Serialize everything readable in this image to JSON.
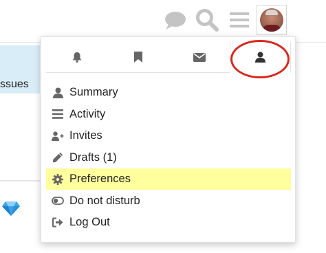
{
  "background": {
    "partial_text": "ssues",
    "highlight_color": "#d9edf9"
  },
  "header": {
    "icons": [
      "chat-icon",
      "search-icon",
      "hamburger-menu-icon",
      "avatar"
    ]
  },
  "user_menu": {
    "tabs": [
      {
        "name": "notifications",
        "icon": "bell-icon"
      },
      {
        "name": "bookmarks",
        "icon": "bookmark-icon"
      },
      {
        "name": "messages",
        "icon": "envelope-icon"
      },
      {
        "name": "profile",
        "icon": "user-icon",
        "selected": true
      }
    ],
    "annotation_color": "#d7281e",
    "items": [
      {
        "label": "Summary",
        "icon": "user-icon"
      },
      {
        "label": "Activity",
        "icon": "stream-icon"
      },
      {
        "label": "Invites",
        "icon": "user-plus-icon"
      },
      {
        "label": "Drafts (1)",
        "icon": "pencil-icon"
      },
      {
        "label": "Preferences",
        "icon": "gear-icon",
        "highlighted": true
      },
      {
        "label": "Do not disturb",
        "icon": "toggle-off-icon"
      },
      {
        "label": "Log Out",
        "icon": "sign-out-icon"
      }
    ],
    "highlight_color": "#ffff9e"
  }
}
